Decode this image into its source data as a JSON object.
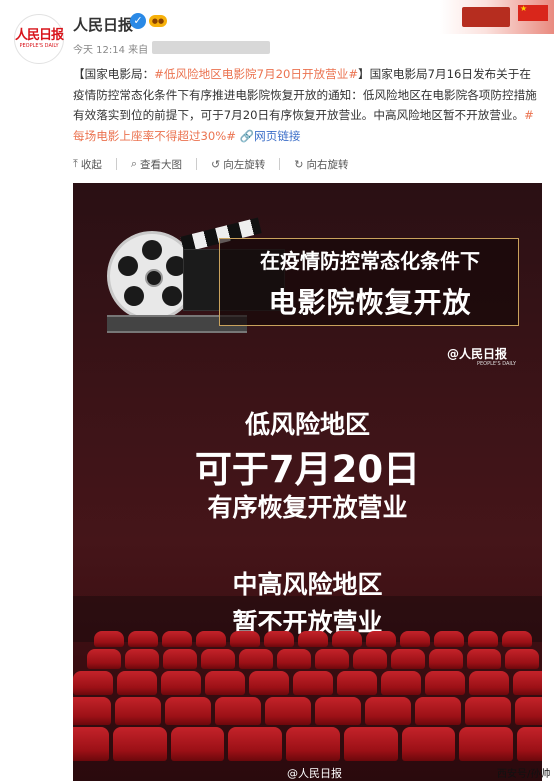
{
  "header": {
    "avatar_logo": "人民日报",
    "avatar_logo_en": "PEOPLE'S DAILY",
    "account_name": "人民日报",
    "meta_time": "今天 12:14 来自"
  },
  "post": {
    "tag_open": "【国家电影局：",
    "hashtag": "#低风险地区电影院7月20日开放营业#",
    "tag_close": "】",
    "body": "国家电影局7月16日发布关于在疫情防控常态化条件下有序推进电影院恢复开放的通知：低风险地区在电影院各项防控措施有效落实到位的前提下，可于7月20日有序恢复开放营业。中高风险地区暂不开放营业。",
    "hashtag2": "#每场电影上座率不得超过30%#",
    "link_icon": "link-icon",
    "link_text": "网页链接"
  },
  "toolbar": {
    "collapse": "收起",
    "view_large": "查看大图",
    "rotate_left": "向左旋转",
    "rotate_right": "向右旋转"
  },
  "poster": {
    "headline1": "在疫情防控常态化条件下",
    "headline2": "电影院恢复开放",
    "logo": "@人民日报",
    "logo_en": "PEOPLE'S DAILY",
    "low_risk": "低风险地区",
    "date_line": "可于7月20日",
    "reopen": "有序恢复开放营业",
    "mid_high_risk": "中高风险地区",
    "not_open": "暂不开放营业",
    "watermark": "@人民日报"
  },
  "corner_text": "西安号/孙帅",
  "colors": {
    "accent_link": "#eb7350",
    "blue_link": "#3b6ec8",
    "poster_bg": "#3b1317",
    "seat_red": "#c4232a"
  }
}
